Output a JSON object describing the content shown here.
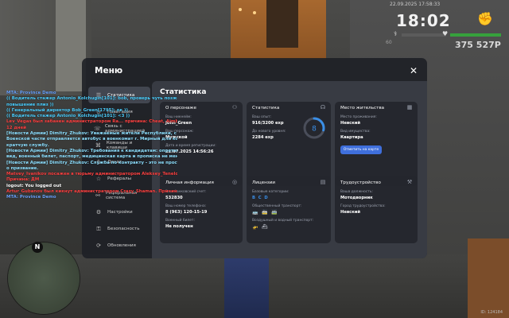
{
  "hud": {
    "date": "22.09.2025 17:58:33",
    "time": "18:02",
    "money": "375 527Р",
    "ping": "60",
    "bottom_right": "ID: 124184"
  },
  "chat": [
    {
      "text": "MTA: Province Demo",
      "color": "#6fa6ff"
    },
    {
      "text": "(( Водитель стажер Antonio_Kolchugin[101]: bob, проверь чуть позже рапорт на",
      "color": "#4fd0ff"
    },
    {
      "text": "повышение плиз ))",
      "color": "#4fd0ff"
    },
    {
      "text": "(( Генеральный директор Bob_Green[1795]: ок ))",
      "color": "#4fd0ff"
    },
    {
      "text": "(( Водитель стажер Antonio_Kolchugin[101]: <3 ))",
      "color": "#4fd0ff"
    },
    {
      "text": "Lev_Vegas был забанен администратором Ra... причина: Cheat, Aimbot, Wallhack",
      "color": "#ff4444"
    },
    {
      "text": "12 дней",
      "color": "#ff4444"
    },
    {
      "text": "[Новости Армии] Dimitry_Zhukov: Уважаемые жители Республики, с территории",
      "color": "#8fe0ff"
    },
    {
      "text": "Военской части отправляется автобус в военкомат г. Мирный для которые на",
      "color": "#8fe0ff"
    },
    {
      "text": "кратчую службу.",
      "color": "#8fe0ff"
    },
    {
      "text": "[Новости Армии] Dimitry_Zhukov: Требования к кандидатам: опретный внешний",
      "color": "#8fe0ff"
    },
    {
      "text": "вид, военный билет, паспорт, медицинская карта и прописка не менее 5 лет.",
      "color": "#8fe0ff"
    },
    {
      "text": "[Новости Армии] Dimitry_Zhukov: Служба по контракту - это не просто работа. Эт",
      "color": "#8fe0ff"
    },
    {
      "text": "о призвание.",
      "color": "#8fe0ff"
    },
    {
      "text": "Matvey_Ivanikov посажен в тюрьму администратором Aleksey_Tenelov на 2 мин.",
      "color": "#ff4444"
    },
    {
      "text": "Причина: ДМ",
      "color": "#ff4444"
    },
    {
      "text": "logout: You logged out",
      "color": "#ffffff"
    },
    {
      "text": "Artur_Gubanov был кикнут администратором Crazy_Shaman. Причина: ДМ",
      "color": "#ff4444"
    },
    {
      "text": "MTA: Province Demo",
      "color": "#6fa6ff"
    }
  ],
  "modal": {
    "title": "Меню",
    "sidebar": [
      {
        "label": "Статистика",
        "icon": "☰",
        "active": true
      },
      {
        "label": "Навигация",
        "icon": "⊙",
        "active": false
      },
      {
        "label": "Связь с администрацией",
        "icon": "☏",
        "active": false
      },
      {
        "label": "Команды и клавиши",
        "icon": "⌘",
        "active": false
      },
      {
        "label": "Донат",
        "icon": "$",
        "active": false
      },
      {
        "label": "Рефералы",
        "icon": "☆",
        "active": false
      },
      {
        "label": "Реферальная система",
        "icon": "⚯",
        "active": false
      },
      {
        "label": "Настройки",
        "icon": "⚙",
        "active": false
      },
      {
        "label": "Безопасность",
        "icon": "⚿",
        "active": false
      },
      {
        "label": "Обновления",
        "icon": "⟳",
        "active": false
      }
    ],
    "content_title": "Статистика",
    "cards": {
      "personal": {
        "title": "О персонаже",
        "name_label": "Ваш никнейм:",
        "name": "John_Green",
        "char_label": "Ваш персонаж:",
        "char": "Мужской",
        "reg_label": "Дата и время регистрации:",
        "reg": "12.07.2025 14:56:26"
      },
      "stats": {
        "title": "Статистика",
        "exp_label": "Ваш опыт:",
        "exp": "916/3200 exp",
        "next_label": "До нового уровня:",
        "next": "2284 exp",
        "level": "8",
        "progress": 0.286
      },
      "residence": {
        "title": "Место жительства",
        "city_label": "Место проживания:",
        "city": "Невский",
        "prop_label": "Вид имущества:",
        "prop": "Квартира",
        "button": "Отметить на карте"
      },
      "info": {
        "title": "Личная информация",
        "bank_label": "Ваш банковский счет:",
        "bank": "532830",
        "phone_label": "Ваш номер телефона:",
        "phone": "8 (963) 120-15-19",
        "military_label": "Военный билет:",
        "military": "Не получен"
      },
      "licenses": {
        "title": "Лицензии",
        "base_label": "Базовые категории:",
        "base": "B C D",
        "public_label": "Общественный транспорт:",
        "air_label": "Воздушный и водный транспорт:"
      },
      "job": {
        "title": "Трудоустройство",
        "position_label": "Ваша должность:",
        "position": "Мотодворник",
        "place_label": "Город трудоустройства:",
        "place": "Невский"
      }
    }
  }
}
